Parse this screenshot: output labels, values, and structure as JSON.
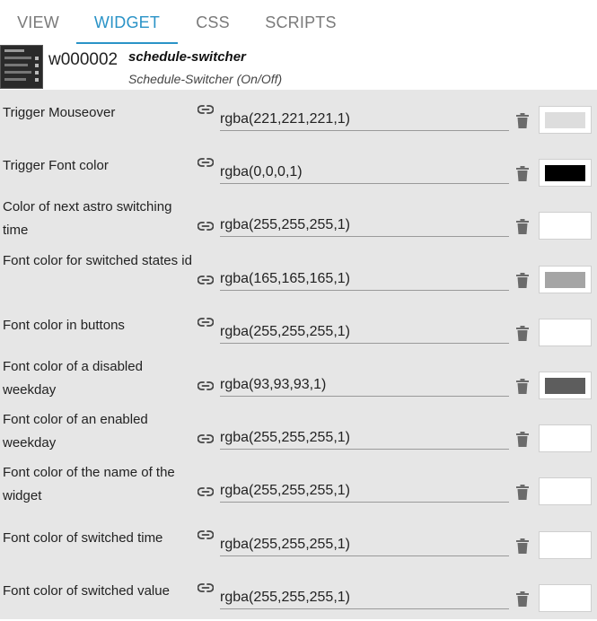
{
  "tabs": [
    {
      "label": "VIEW"
    },
    {
      "label": "WIDGET"
    },
    {
      "label": "CSS"
    },
    {
      "label": "SCRIPTS"
    }
  ],
  "active_tab": "WIDGET",
  "accent_color": "#2a93c7",
  "widget": {
    "id": "w000002",
    "name": "schedule-switcher",
    "title": "Schedule-Switcher (On/Off)"
  },
  "properties": [
    {
      "label": "Trigger Mouseover",
      "value": "rgba(221,221,221,1)",
      "color": "#dddddd"
    },
    {
      "label": "Trigger Font color",
      "value": "rgba(0,0,0,1)",
      "color": "#000000"
    },
    {
      "label": "Color of next astro switching time",
      "value": "rgba(255,255,255,1)",
      "color": "#ffffff"
    },
    {
      "label": "Font color for switched states id",
      "value": "rgba(165,165,165,1)",
      "color": "#a5a5a5"
    },
    {
      "label": "Font color in buttons",
      "value": "rgba(255,255,255,1)",
      "color": "#ffffff"
    },
    {
      "label": "Font color of a disabled weekday",
      "value": "rgba(93,93,93,1)",
      "color": "#5d5d5d"
    },
    {
      "label": "Font color of an enabled weekday",
      "value": "rgba(255,255,255,1)",
      "color": "#ffffff"
    },
    {
      "label": "Font color of the name of the widget",
      "value": "rgba(255,255,255,1)",
      "color": "#ffffff"
    },
    {
      "label": "Font color of switched time",
      "value": "rgba(255,255,255,1)",
      "color": "#ffffff"
    },
    {
      "label": "Font color of switched value",
      "value": "rgba(255,255,255,1)",
      "color": "#ffffff"
    }
  ],
  "icons": {
    "link": "link-icon",
    "delete": "trash-icon"
  }
}
